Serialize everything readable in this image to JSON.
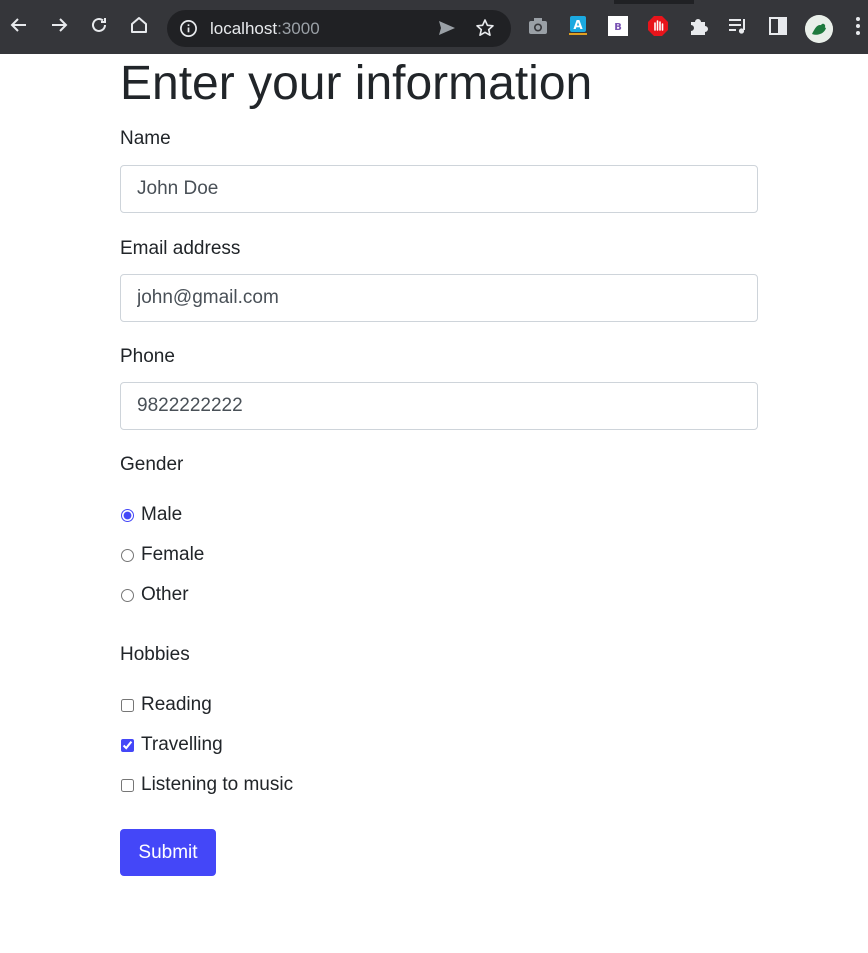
{
  "browser": {
    "url_host": "localhost",
    "url_port": ":3000",
    "icons": {
      "back": "arrow-left-icon",
      "forward": "arrow-right-icon",
      "reload": "reload-icon",
      "home": "home-icon",
      "site_info": "info-icon",
      "send": "send-icon",
      "bookmark": "star-icon",
      "extensions": [
        "camera-icon",
        "translate-icon",
        "bootstrap-icon",
        "stop-hand-icon",
        "puzzle-icon",
        "media-queue-icon",
        "side-panel-icon"
      ],
      "menu": "kebab-menu-icon"
    },
    "extension_letters": {
      "translate": "A",
      "bootstrap": "B"
    },
    "colors": {
      "toolbar": "#35363a",
      "omnibox": "#202124",
      "text": "#e8eaed"
    }
  },
  "form": {
    "title": "Enter your information",
    "name": {
      "label": "Name",
      "value": "John Doe"
    },
    "email": {
      "label": "Email address",
      "value": "john@gmail.com"
    },
    "phone": {
      "label": "Phone",
      "value": "9822222222"
    },
    "gender": {
      "label": "Gender",
      "options": [
        {
          "label": "Male",
          "checked": true
        },
        {
          "label": "Female",
          "checked": false
        },
        {
          "label": "Other",
          "checked": false
        }
      ]
    },
    "hobbies": {
      "label": "Hobbies",
      "options": [
        {
          "label": "Reading",
          "checked": false
        },
        {
          "label": "Travelling",
          "checked": true
        },
        {
          "label": "Listening to music",
          "checked": false
        }
      ]
    },
    "submit_label": "Submit",
    "accent_color": "#4447f8"
  }
}
